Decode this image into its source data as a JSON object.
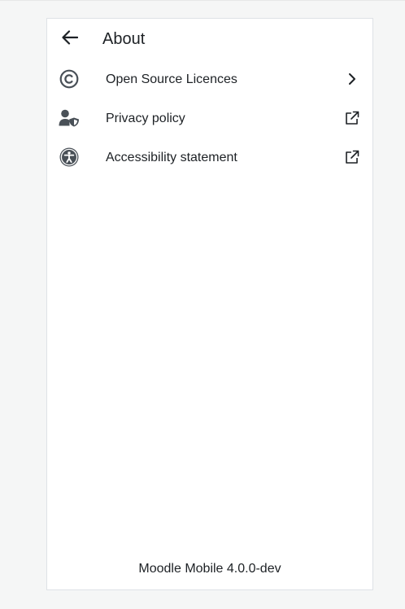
{
  "header": {
    "back_icon": "arrow-left-icon",
    "title": "About"
  },
  "menu": {
    "items": [
      {
        "label": "Open Source Licences",
        "icon": "copyright-icon",
        "trailing_icon": "chevron-right-icon"
      },
      {
        "label": "Privacy policy",
        "icon": "user-shield-icon",
        "trailing_icon": "external-link-icon"
      },
      {
        "label": "Accessibility statement",
        "icon": "universal-access-icon",
        "trailing_icon": "external-link-icon"
      }
    ]
  },
  "footer": {
    "version": "Moodle Mobile 4.0.0-dev"
  },
  "colors": {
    "background": "#f5f6f6",
    "panel": "#ffffff",
    "icon": "#495057",
    "text": "#1d2125"
  }
}
